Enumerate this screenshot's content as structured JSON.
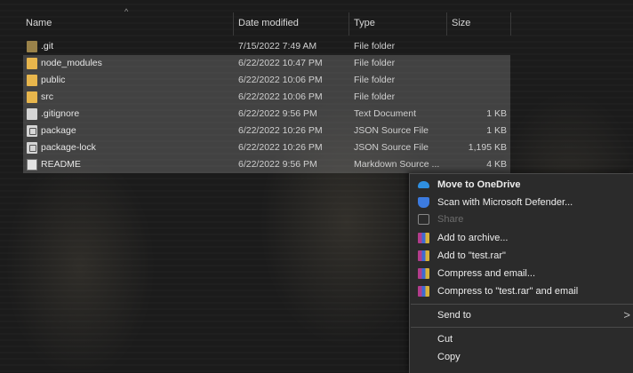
{
  "columns": {
    "name": "Name",
    "date": "Date modified",
    "type": "Type",
    "size": "Size"
  },
  "files": [
    {
      "name": ".git",
      "date": "7/15/2022 7:49 AM",
      "type": "File folder",
      "size": "",
      "icon": "folder-icon",
      "selected": false
    },
    {
      "name": "node_modules",
      "date": "6/22/2022 10:47 PM",
      "type": "File folder",
      "size": "",
      "icon": "folder-icon",
      "selected": true
    },
    {
      "name": "public",
      "date": "6/22/2022 10:06 PM",
      "type": "File folder",
      "size": "",
      "icon": "folder-icon",
      "selected": true
    },
    {
      "name": "src",
      "date": "6/22/2022 10:06 PM",
      "type": "File folder",
      "size": "",
      "icon": "folder-icon",
      "selected": true
    },
    {
      "name": ".gitignore",
      "date": "6/22/2022 9:56 PM",
      "type": "Text Document",
      "size": "1 KB",
      "icon": "file-icon",
      "selected": true
    },
    {
      "name": "package",
      "date": "6/22/2022 10:26 PM",
      "type": "JSON Source File",
      "size": "1 KB",
      "icon": "json-icon",
      "selected": true
    },
    {
      "name": "package-lock",
      "date": "6/22/2022 10:26 PM",
      "type": "JSON Source File",
      "size": "1,195 KB",
      "icon": "json-icon",
      "selected": true
    },
    {
      "name": "README",
      "date": "6/22/2022 9:56 PM",
      "type": "Markdown Source ...",
      "size": "4 KB",
      "icon": "markdown-file-icon",
      "selected": true
    }
  ],
  "context_menu": {
    "move_onedrive": "Move to OneDrive",
    "scan_defender": "Scan with Microsoft Defender...",
    "share": "Share",
    "add_archive": "Add to archive...",
    "add_rar": "Add to \"test.rar\"",
    "compress_email": "Compress and email...",
    "compress_rar_email": "Compress to \"test.rar\" and email",
    "send_to": "Send to",
    "cut": "Cut",
    "copy": "Copy"
  }
}
